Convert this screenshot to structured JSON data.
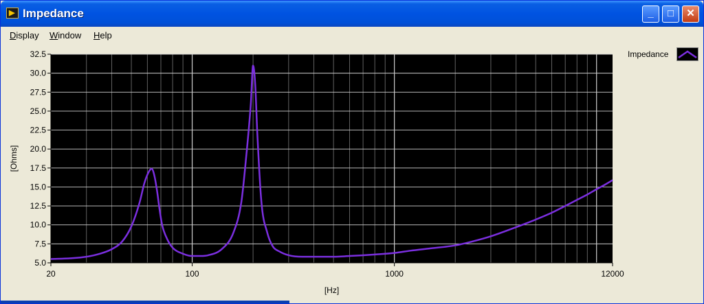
{
  "window": {
    "title": "Impedance",
    "icon": "labview-icon",
    "controls": {
      "minimize": "_",
      "maximize": "□",
      "close": "✕"
    }
  },
  "menu": {
    "items": [
      {
        "mnemonic": "D",
        "rest": "isplay"
      },
      {
        "mnemonic": "W",
        "rest": "indow"
      },
      {
        "mnemonic": "H",
        "rest": "elp"
      }
    ]
  },
  "legend": {
    "label": "Impedance",
    "color": "#7b2fe0"
  },
  "colors": {
    "plot_background": "#000000",
    "grid": "#7a7a7a",
    "trace": "#7b2fe0"
  },
  "chart_data": {
    "type": "line",
    "xlabel": "[Hz]",
    "ylabel": "[Ohms]",
    "x_scale": "log",
    "xlim": [
      20,
      12000
    ],
    "ylim": [
      5.0,
      32.5
    ],
    "x_tick_labels": [
      "20",
      "100",
      "1000",
      "12000"
    ],
    "y_tick_labels": [
      "5.0",
      "7.5",
      "10.0",
      "12.5",
      "15.0",
      "17.5",
      "20.0",
      "22.5",
      "25.0",
      "27.5",
      "30.0",
      "32.5"
    ],
    "grid": true,
    "legend_position": "top-right",
    "series": [
      {
        "name": "Impedance",
        "x": [
          20,
          25,
          30,
          35,
          40,
          45,
          50,
          55,
          58,
          61,
          63,
          65,
          67,
          69,
          71,
          75,
          80,
          90,
          100,
          110,
          120,
          140,
          160,
          175,
          185,
          195,
          200,
          205,
          210,
          220,
          235,
          250,
          270,
          300,
          350,
          400,
          500,
          600,
          700,
          800,
          1000,
          1200,
          1500,
          2000,
          2500,
          3000,
          4000,
          5000,
          6000,
          7000,
          8000,
          9000,
          10000,
          11000,
          12000
        ],
        "y": [
          5.5,
          5.6,
          5.8,
          6.2,
          6.8,
          7.8,
          9.8,
          13.0,
          15.5,
          17.0,
          17.4,
          16.5,
          14.5,
          12.0,
          10.0,
          8.2,
          7.0,
          6.2,
          5.9,
          5.9,
          6.0,
          6.8,
          9.0,
          13.0,
          19.0,
          26.0,
          31.0,
          28.5,
          22.0,
          13.0,
          9.0,
          7.2,
          6.5,
          6.0,
          5.8,
          5.8,
          5.8,
          5.9,
          6.0,
          6.1,
          6.3,
          6.6,
          6.9,
          7.3,
          7.9,
          8.5,
          9.7,
          10.7,
          11.6,
          12.5,
          13.3,
          14.0,
          14.7,
          15.3,
          15.9
        ]
      }
    ]
  }
}
